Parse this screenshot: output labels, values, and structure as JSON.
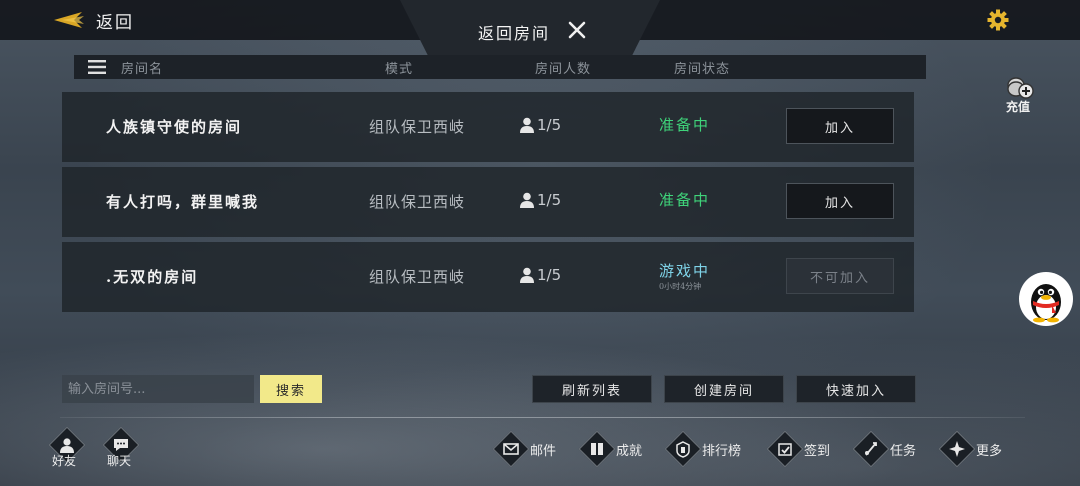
{
  "header": {
    "back_label": "返回",
    "title": "返回房间"
  },
  "table": {
    "columns": [
      "房间名",
      "模式",
      "房间人数",
      "房间状态"
    ],
    "rows": [
      {
        "name": "人族镇守使的房间",
        "mode": "组队保卫西岐",
        "count": "1/5",
        "status": "准备中",
        "status_color": "#3fd37a",
        "status_sub": "",
        "action": "加入",
        "action_enabled": true
      },
      {
        "name": "有人打吗，群里喊我",
        "mode": "组队保卫西岐",
        "count": "1/5",
        "status": "准备中",
        "status_color": "#3fd37a",
        "status_sub": "",
        "action": "加入",
        "action_enabled": true
      },
      {
        "name": ".无双的房间",
        "mode": "组队保卫西岐",
        "count": "1/5",
        "status": "游戏中",
        "status_color": "#7fd3e8",
        "status_sub": "0小时4分钟",
        "action": "不可加入",
        "action_enabled": false
      }
    ]
  },
  "side": {
    "recharge_label": "充值"
  },
  "search": {
    "placeholder": "输入房间号...",
    "button_label": "搜索"
  },
  "actions": {
    "refresh": "刷新列表",
    "create": "创建房间",
    "quick_join": "快速加入"
  },
  "bottom_left": [
    {
      "label": "好友",
      "icon": "friend-icon"
    },
    {
      "label": "聊天",
      "icon": "chat-icon"
    }
  ],
  "bottom_nav": [
    {
      "label": "邮件",
      "icon": "mail-icon"
    },
    {
      "label": "成就",
      "icon": "achievement-icon"
    },
    {
      "label": "排行榜",
      "icon": "leaderboard-icon"
    },
    {
      "label": "签到",
      "icon": "checkin-icon"
    },
    {
      "label": "任务",
      "icon": "task-icon"
    },
    {
      "label": "更多",
      "icon": "more-icon"
    }
  ],
  "colors": {
    "accent_yellow": "#f2e98a",
    "ready_green": "#3fd37a",
    "ingame_cyan": "#7fd3e8",
    "gear_gold": "#e6b52e"
  }
}
